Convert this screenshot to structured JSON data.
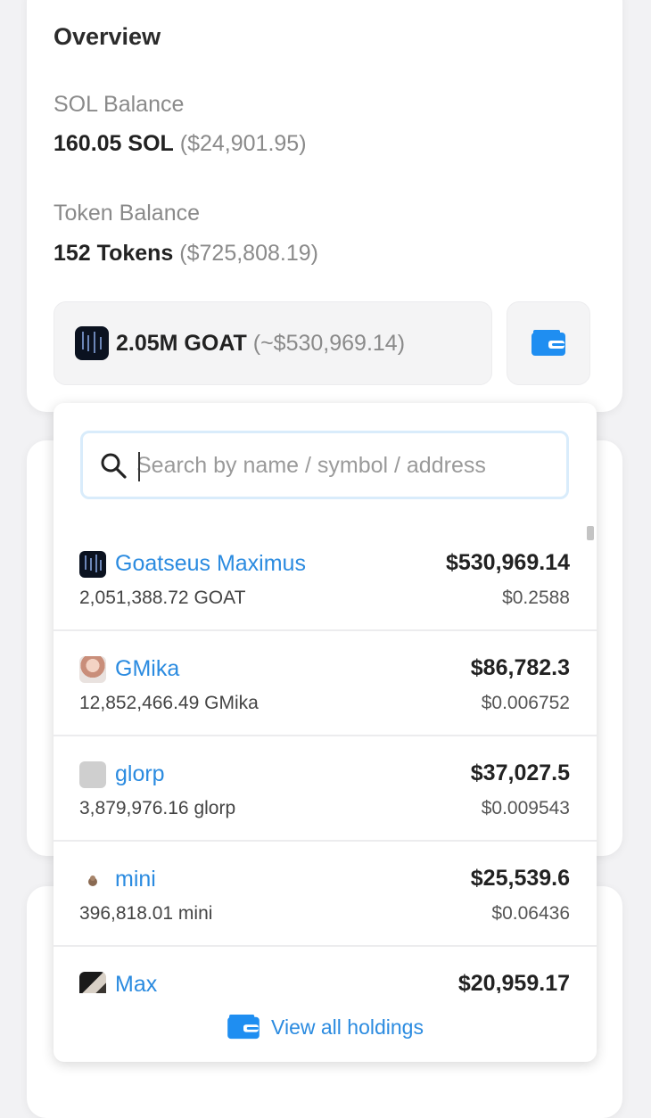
{
  "overview": {
    "title": "Overview",
    "sol_label": "SOL Balance",
    "sol_amount": "160.05 SOL",
    "sol_usd": "($24,901.95)",
    "token_label": "Token Balance",
    "token_count": "152 Tokens",
    "token_usd": "($725,808.19)",
    "selected_token_amount": "2.05M GOAT",
    "selected_token_usd": "(~$530,969.14)",
    "wallet_icon": "wallet-icon"
  },
  "dropdown": {
    "search_placeholder": "Search by name / symbol / address",
    "search_value": "",
    "holdings": [
      {
        "name": "Goatseus Maximus",
        "amount": "2,051,388.72 GOAT",
        "value": "$530,969.14",
        "price": "$0.2588",
        "icon": "goat-token-icon"
      },
      {
        "name": "GMika",
        "amount": "12,852,466.49 GMika",
        "value": "$86,782.3",
        "price": "$0.006752",
        "icon": "gmika-token-icon"
      },
      {
        "name": "glorp",
        "amount": "3,879,976.16 glorp",
        "value": "$37,027.5",
        "price": "$0.009543",
        "icon": "glorp-token-icon"
      },
      {
        "name": "mini",
        "amount": "396,818.01 mini",
        "value": "$25,539.6",
        "price": "$0.06436",
        "icon": "mini-token-icon"
      },
      {
        "name": "Max",
        "amount": "",
        "value": "$20,959.17",
        "price": "",
        "icon": "max-token-icon"
      }
    ],
    "view_all_label": "View all holdings"
  },
  "colors": {
    "accent": "#2b8be0",
    "wallet_blue": "#1f8ef1"
  }
}
